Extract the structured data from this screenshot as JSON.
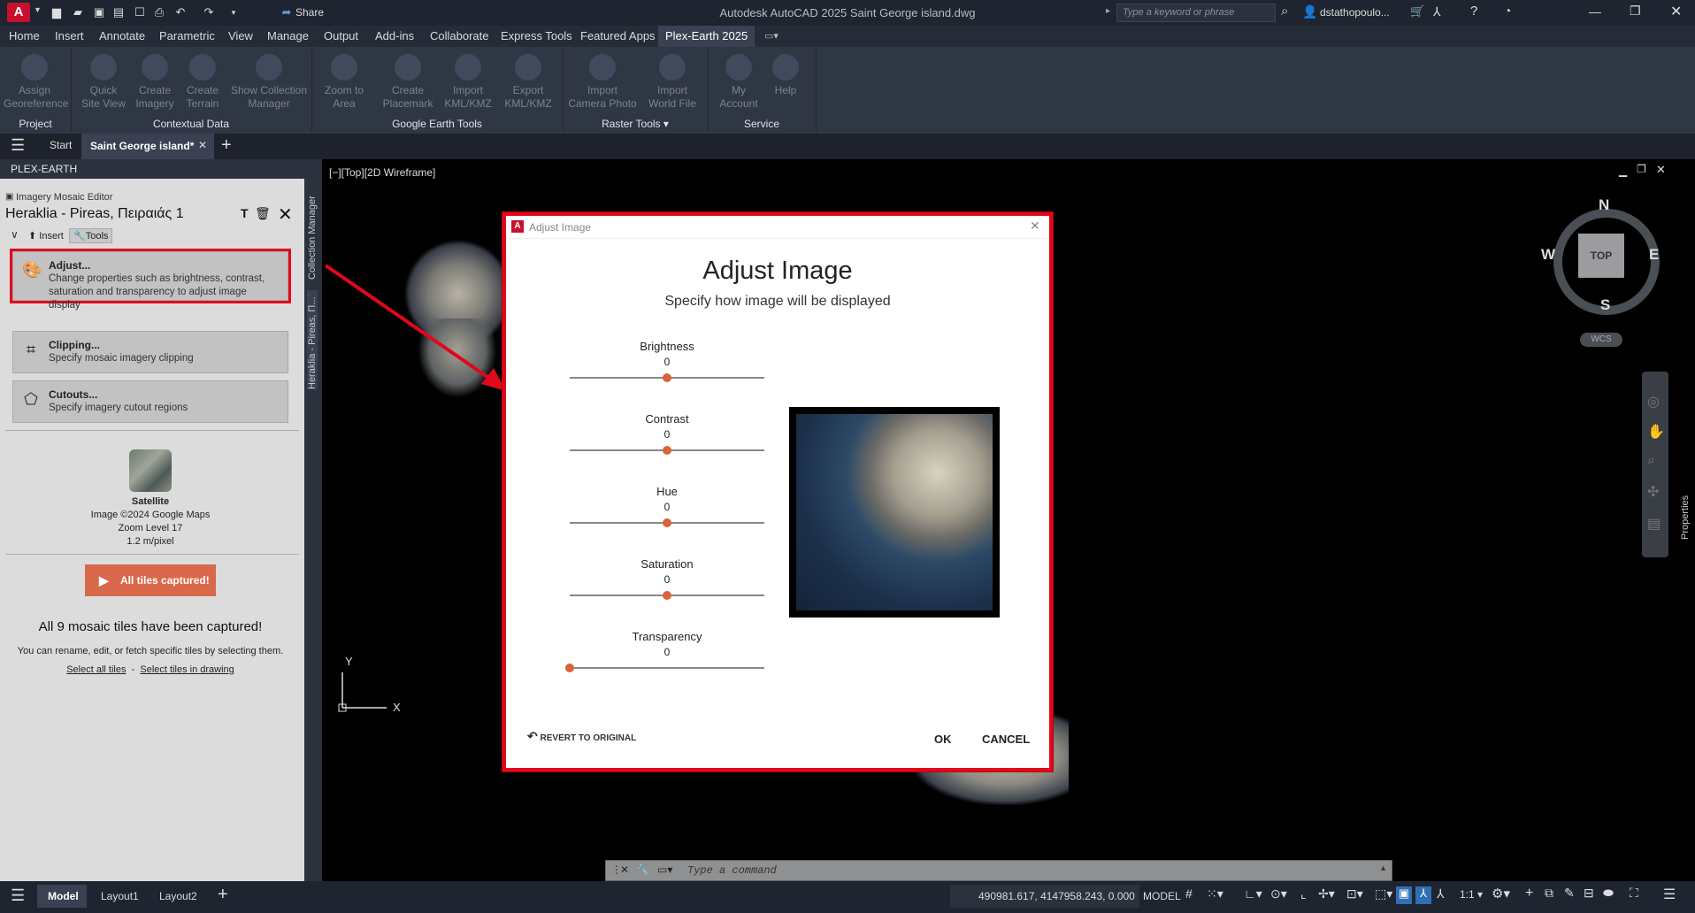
{
  "titlebar": {
    "app_letter": "A",
    "title": "Autodesk AutoCAD 2025   Saint George island.dwg",
    "share": "Share",
    "search_placeholder": "Type a keyword or phrase",
    "user": "dstathopoulo..."
  },
  "ribbon_tabs": [
    "Home",
    "Insert",
    "Annotate",
    "Parametric",
    "View",
    "Manage",
    "Output",
    "Add-ins",
    "Collaborate",
    "Express Tools",
    "Featured Apps",
    "Plex-Earth 2025"
  ],
  "ribbon": {
    "buttons": [
      {
        "l1": "Assign",
        "l2": "Georeference"
      },
      {
        "l1": "Quick",
        "l2": "Site View"
      },
      {
        "l1": "Create",
        "l2": "Imagery"
      },
      {
        "l1": "Create",
        "l2": "Terrain"
      },
      {
        "l1": "Show Collection",
        "l2": "Manager"
      },
      {
        "l1": "Zoom to",
        "l2": "Area"
      },
      {
        "l1": "Create",
        "l2": "Placemark"
      },
      {
        "l1": "Import",
        "l2": "KML/KMZ"
      },
      {
        "l1": "Export",
        "l2": "KML/KMZ"
      },
      {
        "l1": "Import",
        "l2": "Camera Photo"
      },
      {
        "l1": "Import",
        "l2": "World File"
      },
      {
        "l1": "My",
        "l2": "Account"
      },
      {
        "l1": "Help",
        "l2": ""
      }
    ],
    "panels": [
      "Project",
      "Contextual Data",
      "Google Earth Tools",
      "Raster Tools",
      "Service"
    ]
  },
  "doctabs": {
    "start": "Start",
    "active": "Saint George island*"
  },
  "palette": {
    "header": "PLEX-EARTH",
    "editor_label": "Imagery Mosaic Editor",
    "mosaic_title": "Heraklia - Pireas, Πειραιάς 1",
    "tab_insert": "Insert",
    "tab_tools": "Tools",
    "tools": [
      {
        "title": "Adjust...",
        "desc": "Change properties such as brightness, contrast, saturation and transparency to adjust image display"
      },
      {
        "title": "Clipping...",
        "desc": "Specify mosaic imagery clipping"
      },
      {
        "title": "Cutouts...",
        "desc": "Specify imagery cutout regions"
      }
    ],
    "source_name": "Satellite",
    "source_copyright": "Image ©2024 Google Maps",
    "source_zoom": "Zoom Level 17",
    "source_res": "1.2 m/pixel",
    "capture_button": "All tiles captured!",
    "captured_msg": "All 9 mosaic tiles have been captured!",
    "hint": "You can rename, edit, or fetch specific tiles by selecting them.",
    "select_all": "Select all tiles",
    "select_drawing": "Select tiles in drawing",
    "side_collection": "Collection Manager",
    "side_mosaic": "Heraklia - Pireas, Π..."
  },
  "viewport": {
    "label": "[−][Top][2D Wireframe]",
    "compass_n": "N",
    "compass_s": "S",
    "compass_e": "E",
    "compass_w": "W",
    "viewcube": "TOP",
    "wcs": "WCS",
    "properties": "Properties",
    "ucs_x": "X",
    "ucs_y": "Y"
  },
  "dialog": {
    "window_title": "Adjust Image",
    "heading": "Adjust Image",
    "subheading": "Specify how image will be displayed",
    "sliders": [
      {
        "label": "Brightness",
        "value": "0",
        "pos": 0.5
      },
      {
        "label": "Contrast",
        "value": "0",
        "pos": 0.5
      },
      {
        "label": "Hue",
        "value": "0",
        "pos": 0.5
      },
      {
        "label": "Saturation",
        "value": "0",
        "pos": 0.5
      },
      {
        "label": "Transparency",
        "value": "0",
        "pos": 0.0
      }
    ],
    "revert": "REVERT TO ORIGINAL",
    "ok": "OK",
    "cancel": "CANCEL"
  },
  "command": {
    "placeholder": "Type a command"
  },
  "statusbar": {
    "tabs": [
      "Model",
      "Layout1",
      "Layout2"
    ],
    "coords": "490981.617, 4147958.243, 0.000",
    "model": "MODEL",
    "scale": "1:1"
  },
  "colors": {
    "accent_red": "#e0081c",
    "slider": "#d9633b",
    "capture": "#d9684a"
  }
}
